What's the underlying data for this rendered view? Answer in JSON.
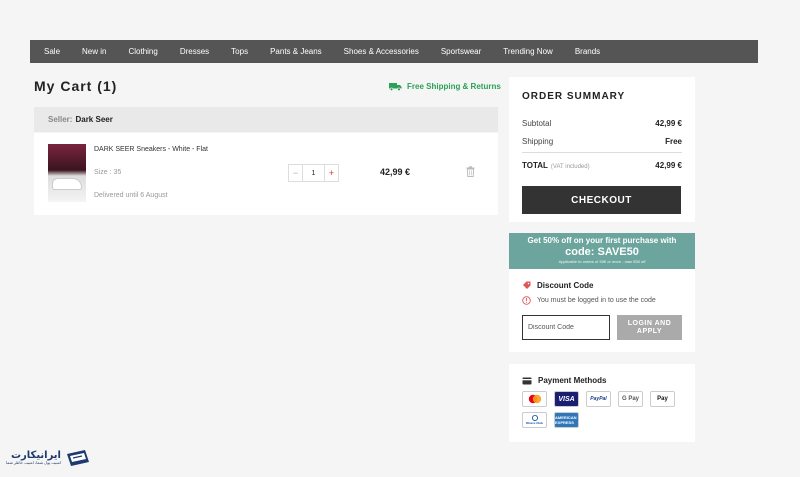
{
  "nav": {
    "items": [
      "Sale",
      "New in",
      "Clothing",
      "Dresses",
      "Tops",
      "Pants & Jeans",
      "Shoes & Accessories",
      "Sportswear",
      "Trending Now",
      "Brands"
    ]
  },
  "cart": {
    "title": "My Cart (1)",
    "free_shipping": "Free Shipping & Returns",
    "seller_label": "Seller:",
    "seller_name": "Dark Seer",
    "item": {
      "name": "DARK SEER Sneakers - White - Flat",
      "size": "Size : 35",
      "delivery": "Delivered until 6 August",
      "quantity": "1",
      "price": "42,99 €"
    }
  },
  "summary": {
    "title": "ORDER SUMMARY",
    "subtotal_label": "Subtotal",
    "subtotal_value": "42,99 €",
    "shipping_label": "Shipping",
    "shipping_value": "Free",
    "total_label": "TOTAL",
    "total_note": "(VAT included)",
    "total_value": "42,99 €",
    "checkout_label": "CHECKOUT"
  },
  "promo": {
    "line1": "Get 50% off on your first purchase with",
    "line2": "code: SAVE50",
    "line3": "Applicable to orders of 50€ or more - max €50 off"
  },
  "discount": {
    "title": "Discount Code",
    "warning": "You must be logged in to use the code",
    "placeholder": "Discount Code",
    "button_line1": "LOGIN AND",
    "button_line2": "APPLY"
  },
  "payments": {
    "title": "Payment Methods",
    "methods": {
      "visa": "VISA",
      "paypal": "PayPal",
      "gpay": "G Pay",
      "apay": " Pay",
      "amex": "AMERICAN EXPRESS",
      "diners": "Diners Club"
    }
  },
  "brand": {
    "name": "ایرانیکارت",
    "tagline": "امنیت پول شما، امنیت خاطر شما"
  },
  "colors": {
    "nav_bg": "#555555",
    "shipping_green": "#2aa05a",
    "checkout_bg": "#333333",
    "promo_bg": "#6ba59d",
    "login_btn_bg": "#aaaaaa",
    "accent_red": "#dd3333"
  }
}
